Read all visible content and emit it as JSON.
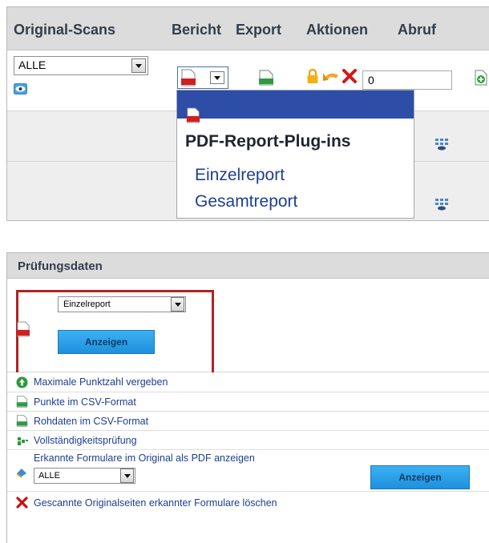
{
  "panel1": {
    "menu": [
      "Original-Scans",
      "Bericht",
      "Export",
      "Aktionen",
      "Abruf"
    ],
    "filter_value": "ALLE",
    "csv_label": "CSV",
    "count_value": "0",
    "dropdown": {
      "title": "PDF-Report-Plug-ins",
      "items": [
        "Einzelreport",
        "Gesamtreport"
      ]
    },
    "pdf_label": "PDF"
  },
  "panel2": {
    "title": "Prüfungsdaten",
    "report_select": "Einzelreport",
    "show_button": "Anzeigen",
    "links": [
      "Maximale Punktzahl vergeben",
      "Punkte im CSV-Format",
      "Rohdaten im CSV-Format",
      "Vollständigkeitsprüfung"
    ],
    "original_pdf_label": "Erkannte Formulare im Original als PDF anzeigen",
    "original_pdf_select": "ALLE",
    "original_pdf_button": "Anzeigen",
    "delete_label": "Gescannte Originalseiten erkannter Formulare löschen",
    "csv_label": "CSV"
  },
  "colors": {
    "header_bg": "#dcdcdc",
    "dropdown_bar": "#2e4da7",
    "link_text": "#1f3e92",
    "highlight_border": "#b22222",
    "button_blue": "#1e90dd",
    "delete_red": "#cc1111",
    "add_green": "#2a9a3a"
  }
}
